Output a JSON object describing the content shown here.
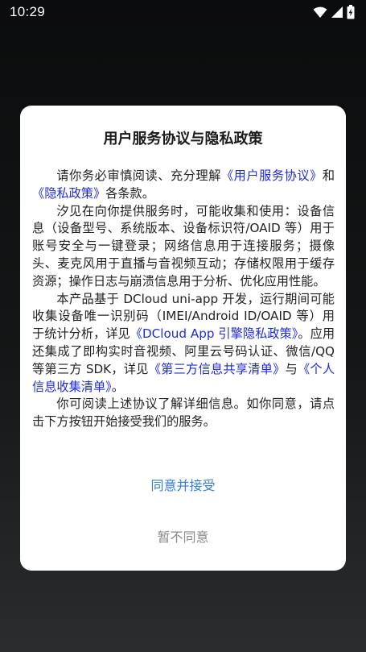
{
  "status_bar": {
    "time": "10:29",
    "icons": [
      "wifi-icon",
      "cellular-signal-icon",
      "battery-charging-icon"
    ]
  },
  "dialog": {
    "title": "用户服务协议与隐私政策",
    "p1": {
      "t1": "请你务必审慎阅读、充分理解",
      "l1": "《用户服务协议》",
      "t2": "和",
      "l2": "《隐私政策》",
      "t3": "各条款。"
    },
    "p2": {
      "t1": "汐见在向你提供服务时，可能收集和使用：设备信息（设备型号、系统版本、设备标识符/OAID 等）用于账号安全与一键登录；网络信息用于连接服务；摄像头、麦克风用于直播与音视频互动；存储权限用于缓存资源；操作日志与崩溃信息用于分析、优化应用性能。"
    },
    "p3": {
      "t1": "本产品基于 DCloud uni-app 开发，运行期间可能收集设备唯一识别码（IMEI/Android ID/OAID 等）用于统计分析，详见",
      "l1": "《DCloud App 引擎隐私政策》",
      "t2": "。应用还集成了即构实时音视频、阿里云号码认证、微信/QQ 等第三方 SDK，详见",
      "l2": "《第三方信息共享清单》",
      "t3": "与",
      "l3": "《个人信息收集清单》",
      "t4": "。"
    },
    "p4": {
      "t1": "你可阅读上述协议了解详细信息。如你同意，请点击下方按钮开始接受我们的服务。"
    },
    "agree_label": "同意并接受",
    "disagree_label": "暂不同意"
  },
  "colors": {
    "link": "#1f2bd6",
    "agree": "#2f7fd6",
    "disagree": "#8a8a8a"
  }
}
